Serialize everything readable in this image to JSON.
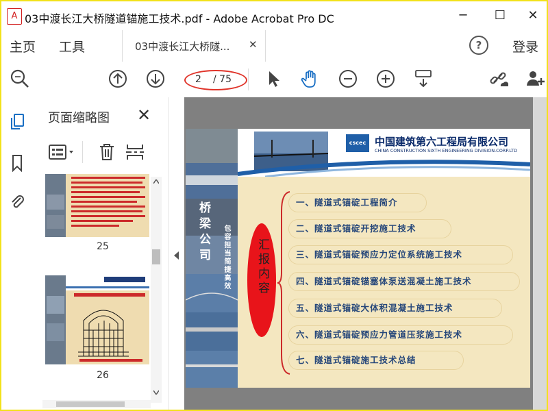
{
  "window": {
    "title": "03中渡长江大桥隧道锚施工技术.pdf - Adobe Acrobat Pro DC",
    "app_icon_glyph": "A",
    "minimize_glyph": "─",
    "maximize_glyph": "☐",
    "close_glyph": "✕"
  },
  "menu": {
    "home": "主页",
    "tools": "工具",
    "login": "登录",
    "help_glyph": "?"
  },
  "tab": {
    "label": "03中渡长江大桥隧...",
    "close_glyph": "✕"
  },
  "toolbar": {
    "page_current": "2",
    "page_total": "/ 75"
  },
  "thumbnails_panel": {
    "title": "页面缩略图",
    "close_glyph": "✕",
    "pages": [
      {
        "label": "25"
      },
      {
        "label": "26"
      }
    ]
  },
  "slide": {
    "company_name": "中国建筑第六工程局有限公司",
    "company_name_en": "CHINA CONSTRUCTION SIXTH ENGINEERING DIVISION.CORP.LTD",
    "logo_text": "cscec",
    "left_title": "桥梁公司",
    "left_subtitle": "包容担当简捷高效",
    "oval_text": "汇报内容",
    "items": [
      "一、隧道式锚碇工程简介",
      "二、隧道式锚碇开挖施工技术",
      "三、隧道式锚碇预应力定位系统施工技术",
      "四、隧道式锚碇锚塞体泵送混凝土施工技术",
      "五、隧道式锚碇大体积混凝土施工技术",
      "六、隧道式锚碇预应力管道压浆施工技术",
      "七、隧道式锚碇施工技术总结"
    ]
  },
  "colors": {
    "accent": "#e8141a",
    "highlight_border": "#f2e21a",
    "slide_bg": "#f4e7c0",
    "item_text": "#26477a"
  }
}
